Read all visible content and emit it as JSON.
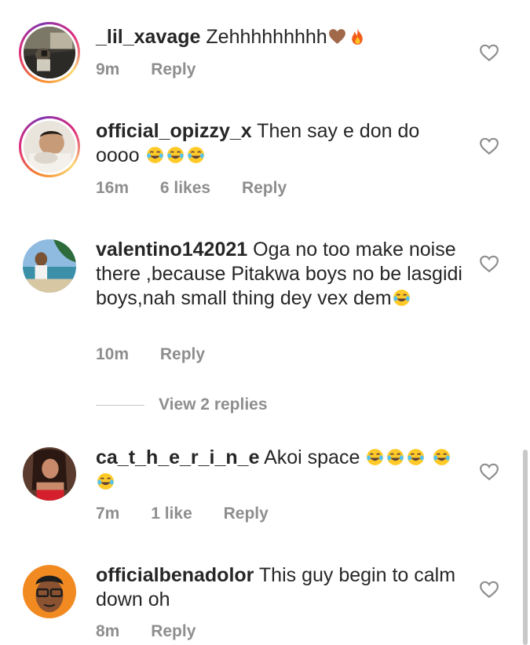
{
  "comments": [
    {
      "username": "_lil_xavage",
      "text": "Zehhhhhhhhh",
      "emojis_after": [
        "brown-heart-icon",
        "fire-icon"
      ],
      "time": "9m",
      "likes": "",
      "reply_label": "Reply",
      "avatar": "avatar-person-car",
      "has_story": true
    },
    {
      "username": "official_opizzy_x",
      "text": "Then say e don do oooo",
      "emojis_after": [
        "tears-of-joy-icon",
        "tears-of-joy-icon",
        "tears-of-joy-icon"
      ],
      "time": "16m",
      "likes": "6 likes",
      "reply_label": "Reply",
      "avatar": "avatar-man-lying",
      "has_story": true
    },
    {
      "username": "valentino142021",
      "text": "Oga no too make noise there ,because Pitakwa boys no be lasgidi boys,nah small thing dey vex dem",
      "emojis_after": [
        "tears-of-joy-icon"
      ],
      "time": "10m",
      "likes": "",
      "reply_label": "Reply",
      "avatar": "avatar-beach",
      "has_story": false
    },
    {
      "username": "ca_t_h_e_r_i_n_e",
      "text": "Akoi space",
      "emojis_after": [
        "tears-of-joy-icon",
        "tears-of-joy-icon",
        "tears-of-joy-icon",
        "tears-of-joy-icon",
        "tears-of-joy-icon"
      ],
      "time": "7m",
      "likes": "1 like",
      "reply_label": "Reply",
      "avatar": "avatar-woman-red",
      "has_story": false
    },
    {
      "username": "officialbenadolor",
      "text": "This guy begin to calm down oh",
      "emojis_after": [],
      "time": "8m",
      "likes": "",
      "reply_label": "Reply",
      "avatar": "avatar-memoji",
      "has_story": false
    }
  ],
  "view_replies": "View 2 replies",
  "colors": {
    "text": "#262626",
    "secondary": "#8e8e8e",
    "heart_outline": "#8e8e8e"
  }
}
